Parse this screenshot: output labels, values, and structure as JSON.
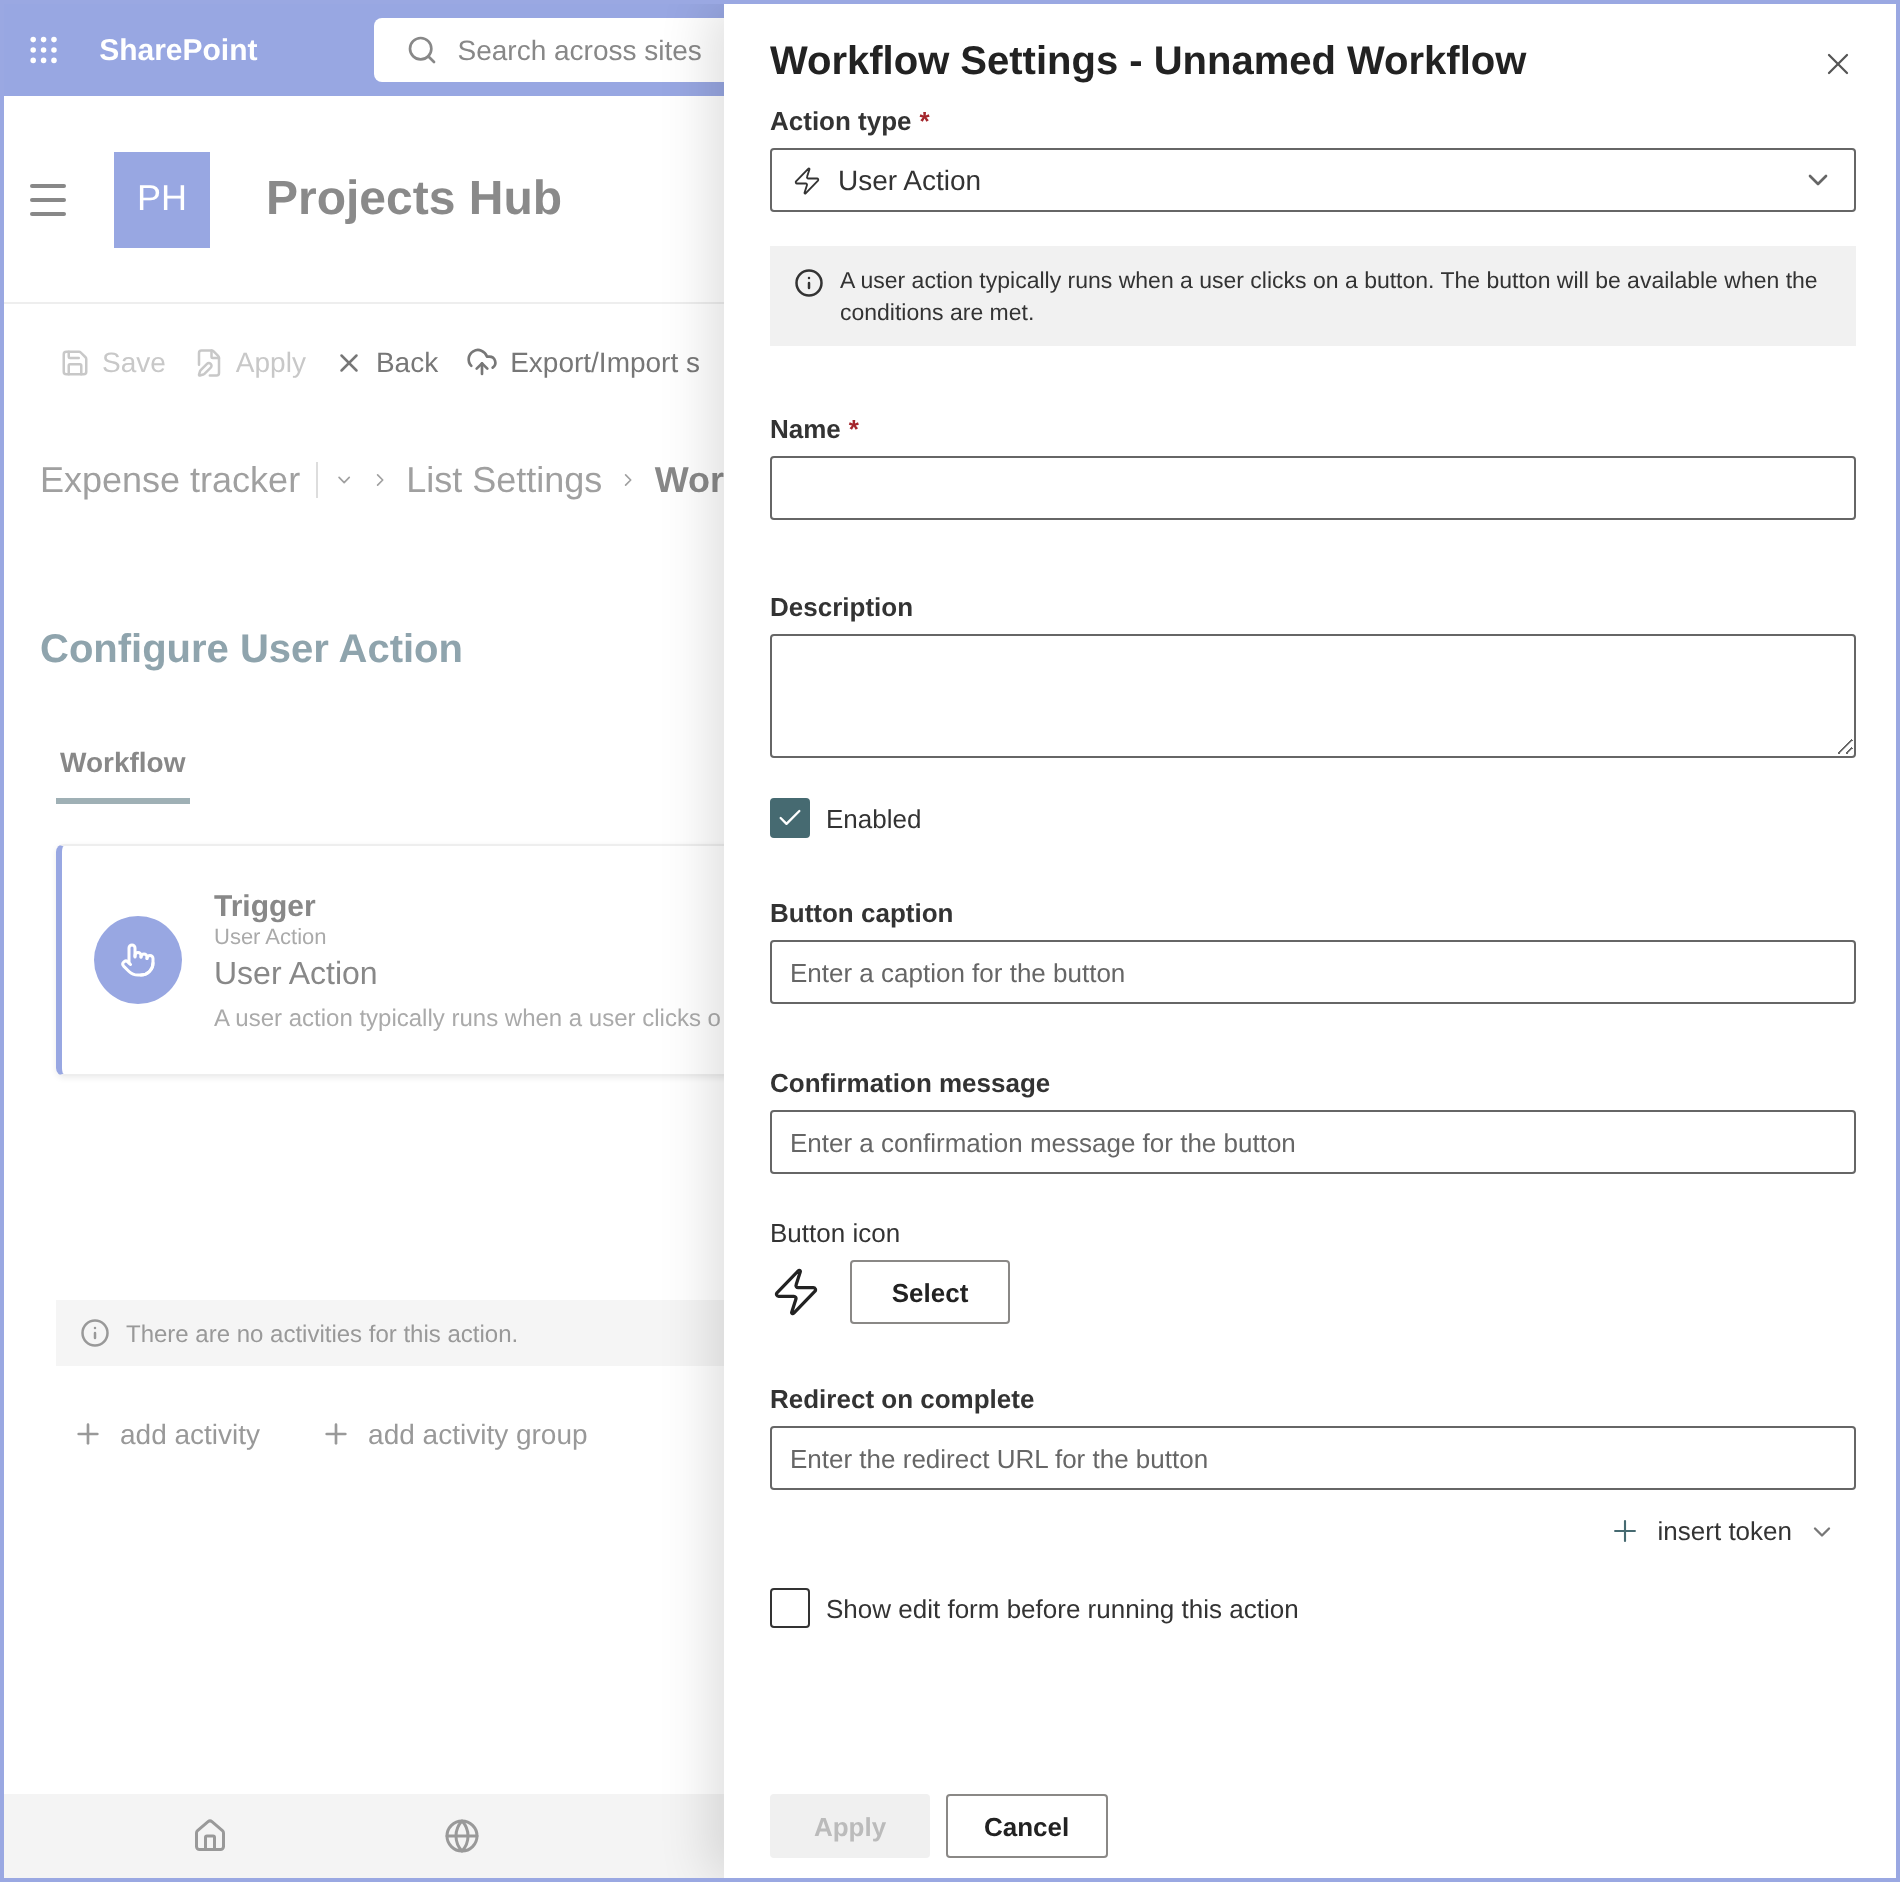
{
  "app_bar": {
    "brand": "SharePoint",
    "search": {
      "placeholder": "Search across sites"
    }
  },
  "site": {
    "logo": "PH",
    "title": "Projects Hub"
  },
  "toolbar": [
    {
      "label": "Save",
      "disabled": true
    },
    {
      "label": "Apply",
      "disabled": true
    },
    {
      "label": "Back",
      "disabled": false
    },
    {
      "label": "Export/Import s",
      "disabled": false
    }
  ],
  "breadcrumb": {
    "root": "Expense tracker",
    "items": [
      {
        "label": "List Settings",
        "current": false
      },
      {
        "label": "Wor",
        "current": true
      }
    ]
  },
  "page_title": "Configure User Action",
  "tabs": [
    {
      "label": "Workflow",
      "selected": true
    }
  ],
  "trigger_card": {
    "heading": "Trigger",
    "type": "User Action",
    "title": "User Action",
    "description": "A user action typically runs when a user clicks o"
  },
  "notice": "There are no activities for this action.",
  "add_links": [
    "add activity",
    "add activity group"
  ],
  "panel": {
    "title": "Workflow Settings - Unnamed Workflow",
    "action_type": {
      "label": "Action type",
      "required_mark": "*",
      "value": "User Action"
    },
    "info": "A user action typically runs when a user clicks on a button. The button will be available when the conditions are met.",
    "fields": [
      {
        "kind": "input",
        "label": "Name",
        "required_mark": "*"
      },
      {
        "kind": "textarea",
        "label": "Description"
      },
      {
        "kind": "checkbox",
        "label": "Enabled",
        "checked": true
      },
      {
        "kind": "input",
        "label": "Button caption",
        "placeholder": "Enter a caption for the button"
      },
      {
        "kind": "input",
        "label": "Confirmation message",
        "placeholder": "Enter a confirmation message for the button"
      },
      {
        "kind": "icon",
        "label": "Button icon",
        "button": "Select"
      },
      {
        "kind": "input",
        "label": "Redirect on complete",
        "placeholder": "Enter the redirect URL for the button"
      },
      {
        "kind": "token",
        "label": "insert token"
      },
      {
        "kind": "checkbox",
        "label": "Show edit form before running this action",
        "checked": false
      }
    ],
    "footer": [
      {
        "label": "Apply",
        "disabled": true
      },
      {
        "label": "Cancel",
        "disabled": false
      }
    ]
  }
}
